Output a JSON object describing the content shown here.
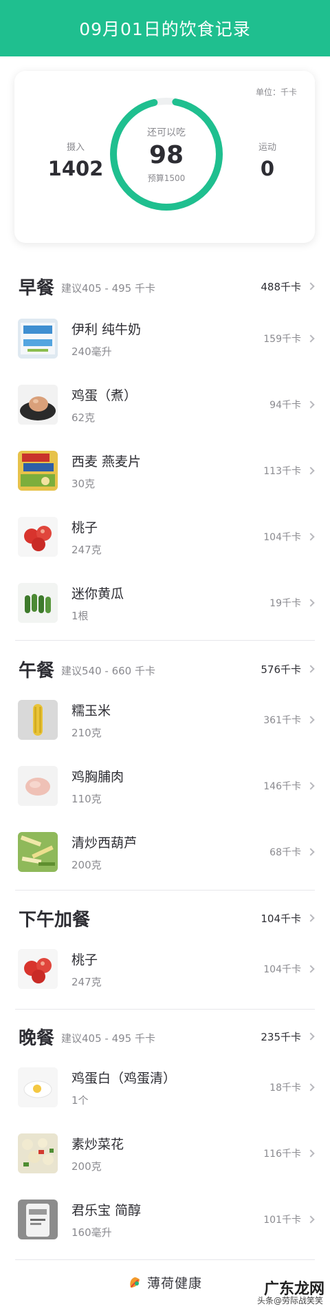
{
  "header": {
    "title": "09月01日的饮食记录"
  },
  "summary": {
    "unit": "单位：千卡",
    "intake_label": "摄入",
    "intake_value": "1402",
    "remaining_label": "还可以吃",
    "remaining_value": "98",
    "budget_text": "预算1500",
    "exercise_label": "运动",
    "exercise_value": "0",
    "progress_fraction": 0.935,
    "accent_color": "#1fbf8f"
  },
  "breakfast": {
    "title": "早餐",
    "suggestion": "建议405 - 495 千卡",
    "total": "488千卡",
    "items": [
      {
        "name": "伊利 纯牛奶",
        "amount": "240毫升",
        "kcal": "159千卡",
        "icon": "milk-carton-icon"
      },
      {
        "name": "鸡蛋（煮）",
        "amount": "62克",
        "kcal": "94千卡",
        "icon": "boiled-egg-icon"
      },
      {
        "name": "西麦 燕麦片",
        "amount": "30克",
        "kcal": "113千卡",
        "icon": "oatmeal-bag-icon"
      },
      {
        "name": "桃子",
        "amount": "247克",
        "kcal": "104千卡",
        "icon": "peach-icon"
      },
      {
        "name": "迷你黄瓜",
        "amount": "1根",
        "kcal": "19千卡",
        "icon": "cucumber-icon"
      }
    ]
  },
  "lunch": {
    "title": "午餐",
    "suggestion": "建议540 - 660 千卡",
    "total": "576千卡",
    "items": [
      {
        "name": "糯玉米",
        "amount": "210克",
        "kcal": "361千卡",
        "icon": "corn-icon"
      },
      {
        "name": "鸡胸脯肉",
        "amount": "110克",
        "kcal": "146千卡",
        "icon": "chicken-breast-icon"
      },
      {
        "name": "清炒西葫芦",
        "amount": "200克",
        "kcal": "68千卡",
        "icon": "zucchini-stirfry-icon"
      }
    ]
  },
  "snack": {
    "title": "下午加餐",
    "total": "104千卡",
    "items": [
      {
        "name": "桃子",
        "amount": "247克",
        "kcal": "104千卡",
        "icon": "peach-icon"
      }
    ]
  },
  "dinner": {
    "title": "晚餐",
    "suggestion": "建议405 - 495 千卡",
    "total": "235千卡",
    "items": [
      {
        "name": "鸡蛋白（鸡蛋清）",
        "amount": "1个",
        "kcal": "18千卡",
        "icon": "egg-white-icon"
      },
      {
        "name": "素炒菜花",
        "amount": "200克",
        "kcal": "116千卡",
        "icon": "cauliflower-stirfry-icon"
      },
      {
        "name": "君乐宝 简醇",
        "amount": "160毫升",
        "kcal": "101千卡",
        "icon": "yogurt-bottle-icon"
      }
    ]
  },
  "footer": {
    "brand": "薄荷健康"
  },
  "watermark": {
    "main": "广东龙网",
    "sub": "头条@劳际战笑笑"
  }
}
